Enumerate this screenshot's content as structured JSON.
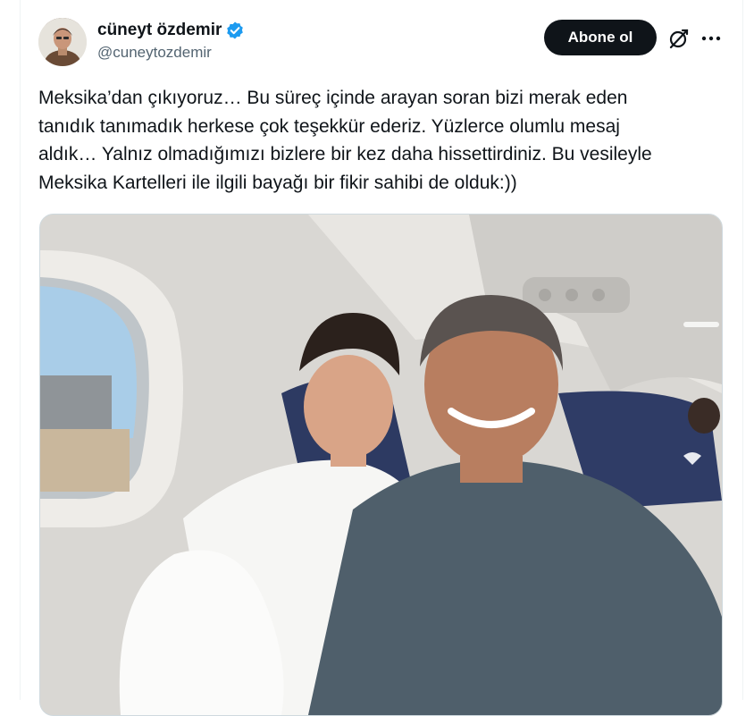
{
  "author": {
    "display_name": "cüneyt özdemir",
    "handle": "@cuneytozdemir",
    "verified": true,
    "verified_color": "#1d9bf0"
  },
  "actions": {
    "follow_label": "Abone ol",
    "grok_icon": "grok-icon",
    "more_icon": "more-icon"
  },
  "tweet": {
    "lines": [
      "Meksika’dan çıkıyoruz… Bu süreç içinde arayan soran bizi merak eden",
      "tanıdık tanımadık herkese çok teşekkür ederiz. Yüzlerce olumlu mesaj",
      "aldık… Yalnız olmadığımızı bizlere bir kez daha hissettirdiniz. Bu vesileyle",
      "Meksika Kartelleri ile ilgili bayağı bir fikir sahibi de olduk:))"
    ]
  },
  "media": {
    "type": "photo",
    "subject": "airplane-cabin-selfie"
  },
  "colors": {
    "text": "#0f1419",
    "secondary": "#536471",
    "button_bg": "#0f1419",
    "border": "#eff3f4"
  }
}
